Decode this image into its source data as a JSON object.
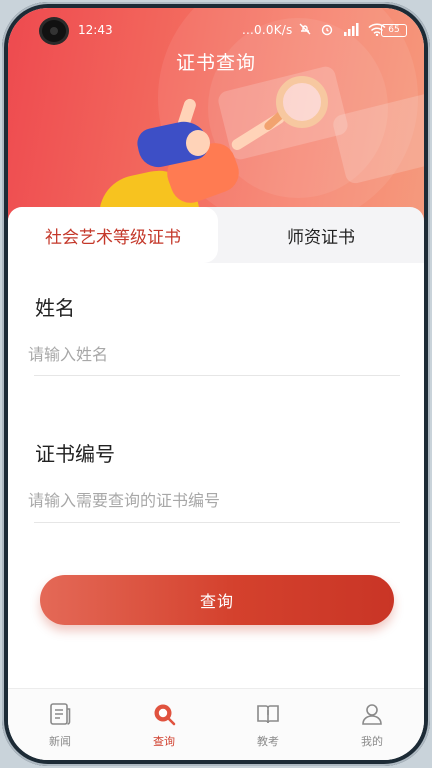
{
  "status_bar": {
    "time": "12:43",
    "network_speed": "...0.0K/s",
    "battery": "65"
  },
  "header": {
    "title": "证书查询"
  },
  "tabs": [
    {
      "label": "社会艺术等级证书",
      "active": true
    },
    {
      "label": "师资证书",
      "active": false
    }
  ],
  "form": {
    "name_label": "姓名",
    "name_placeholder": "请输入姓名",
    "name_value": "",
    "cert_label": "证书编号",
    "cert_placeholder": "请输入需要查询的证书编号",
    "cert_value": "",
    "submit_label": "查询"
  },
  "bottom_nav": [
    {
      "label": "新闻",
      "icon": "news-icon",
      "active": false
    },
    {
      "label": "查询",
      "icon": "search-icon",
      "active": true
    },
    {
      "label": "教考",
      "icon": "book-icon",
      "active": false
    },
    {
      "label": "我的",
      "icon": "user-icon",
      "active": false
    }
  ],
  "colors": {
    "accent": "#d0402e",
    "banner_start": "#ee4a4f",
    "banner_end": "#f59a7d"
  }
}
